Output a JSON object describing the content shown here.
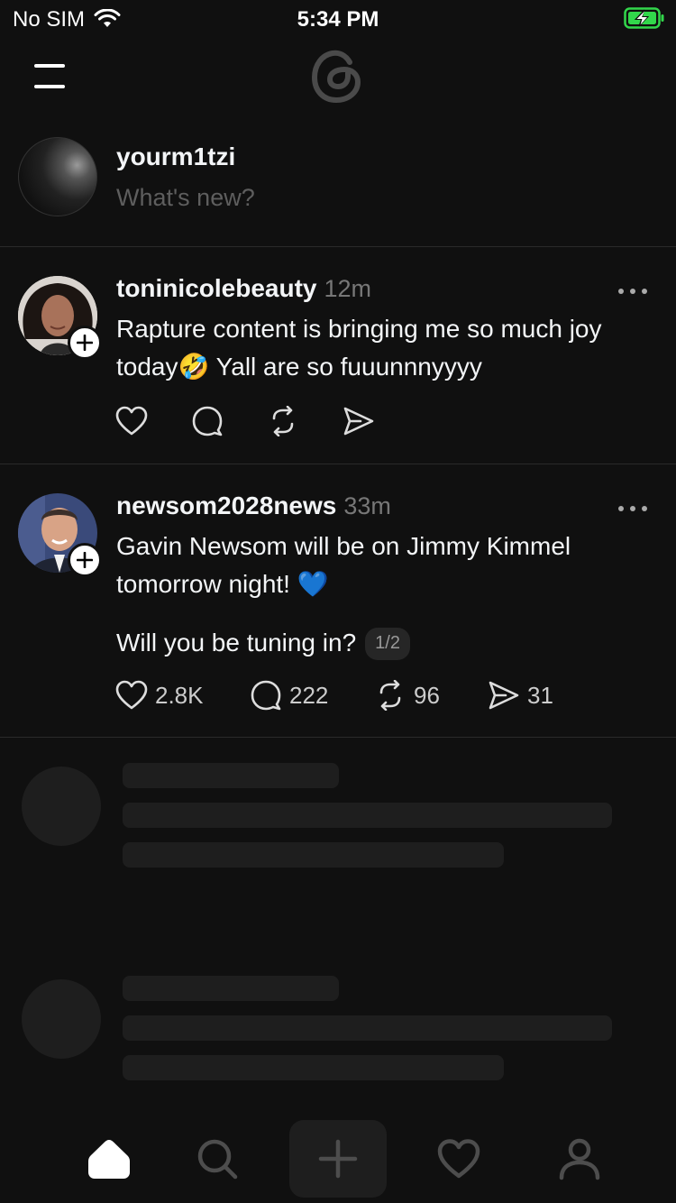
{
  "status": {
    "carrier": "No SIM",
    "time": "5:34 PM"
  },
  "composer": {
    "username": "yourm1tzi",
    "placeholder": "What's new?"
  },
  "posts": [
    {
      "author": "toninicolebeauty",
      "time": "12m",
      "text_line1": "Rapture content is bringing me so much joy",
      "text_line2_a": "today",
      "emoji": "🤣",
      "text_line2_b": " Yall are so fuuunnnyyyy",
      "stats": {
        "likes": "",
        "replies": "",
        "reposts": "",
        "shares": ""
      }
    },
    {
      "author": "newsom2028news",
      "time": "33m",
      "text_line1": "Gavin Newsom will be on Jimmy Kimmel",
      "text_line2": "tomorrow night! 💙",
      "text_line3": "Will you be tuning in?",
      "page_indicator": "1/2",
      "stats": {
        "likes": "2.8K",
        "replies": "222",
        "reposts": "96",
        "shares": "31"
      }
    }
  ],
  "tabs": [
    "home",
    "search",
    "new-thread",
    "activity",
    "profile"
  ],
  "colors": {
    "background": "#101010",
    "text": "#f3f5f7",
    "muted": "#777777",
    "skeleton": "#1e1e1e",
    "battery": "#32d74b"
  }
}
